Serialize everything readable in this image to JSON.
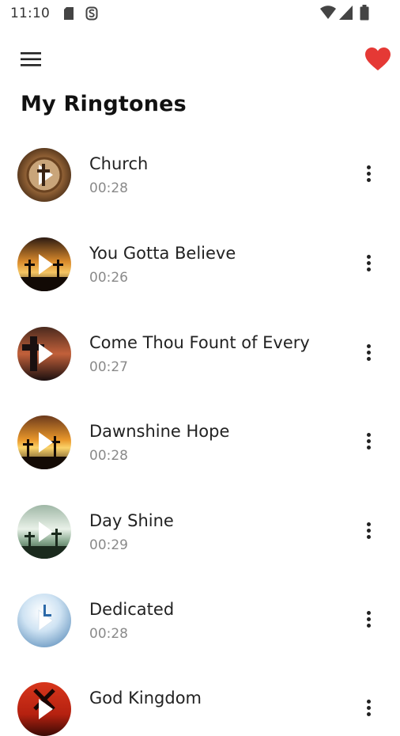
{
  "status_bar": {
    "time": "11:10",
    "icons": [
      "sd-card-icon",
      "s-sync-icon",
      "wifi-icon",
      "cell-signal-icon",
      "battery-icon"
    ]
  },
  "app_bar": {
    "menu_icon": "hamburger-menu-icon",
    "favorite_icon": "heart-icon",
    "favorite_color": "#e53935"
  },
  "page": {
    "title": "My Ringtones"
  },
  "ringtones": [
    {
      "title": "Church",
      "duration": "00:28"
    },
    {
      "title": "You Gotta Believe",
      "duration": "00:26"
    },
    {
      "title": "Come Thou Fount of Every",
      "duration": "00:27"
    },
    {
      "title": "Dawnshine Hope",
      "duration": "00:28"
    },
    {
      "title": "Day Shine",
      "duration": "00:29"
    },
    {
      "title": "Dedicated",
      "duration": "00:28"
    },
    {
      "title": "God Kingdom",
      "duration": ""
    }
  ],
  "colors": {
    "text_primary": "#222222",
    "text_secondary": "#8a8a8a",
    "accent": "#e53935"
  }
}
